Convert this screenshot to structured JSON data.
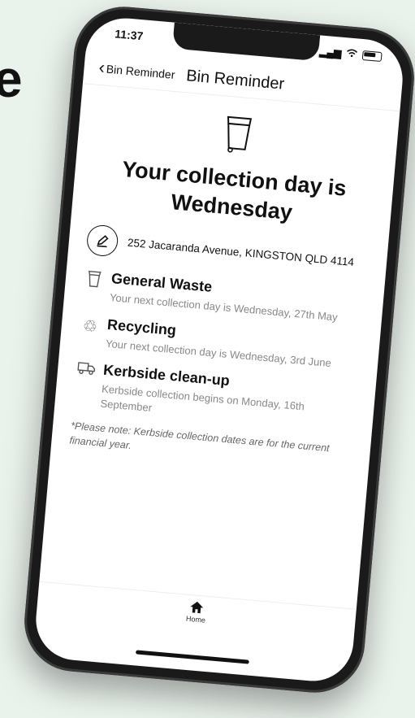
{
  "page": {
    "fragment_text": "e"
  },
  "status_bar": {
    "time": "11:37"
  },
  "nav": {
    "back_label": "Bin Reminder",
    "title": "Bin Reminder"
  },
  "hero": {
    "headline": "Your collection day is Wednesday"
  },
  "address": {
    "text": "252 Jacaranda Avenue, KINGSTON QLD 4114"
  },
  "sections": [
    {
      "title": "General Waste",
      "description": "Your next collection day is Wednesday, 27th May"
    },
    {
      "title": "Recycling",
      "description": "Your next collection day is Wednesday, 3rd June"
    },
    {
      "title": "Kerbside clean-up",
      "description": "Kerbside collection begins on Monday, 16th September"
    }
  ],
  "note": "*Please note: Kerbside collection dates are for the current financial year.",
  "tabbar": {
    "home_label": "Home"
  }
}
